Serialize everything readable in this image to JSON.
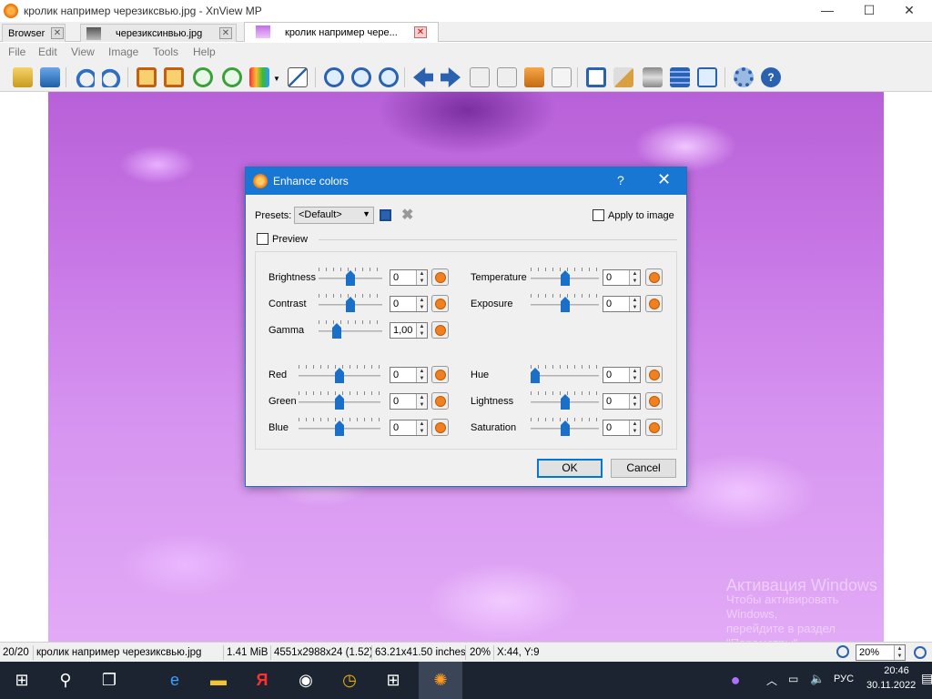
{
  "window": {
    "title": "кролик например черезиксвью.jpg - XnView MP",
    "min": "—",
    "max": "☐",
    "close": "✕"
  },
  "tabs": [
    {
      "label": "Browser"
    },
    {
      "label": "черезиксинвью.jpg"
    },
    {
      "label": "кролик например чере..."
    }
  ],
  "menu": [
    "File",
    "Edit",
    "View",
    "Image",
    "Tools",
    "Help"
  ],
  "watermark": {
    "line1": "Активация Windows",
    "line2": "Чтобы активировать Windows,",
    "line3": "перейдите в раздел \"Параметры\"."
  },
  "dialog": {
    "title": "Enhance colors",
    "help": "?",
    "close": "✕",
    "presets_label": "Presets:",
    "presets_value": "<Default>",
    "apply_label": "Apply to image",
    "preview_label": "Preview",
    "left_controls": [
      {
        "label": "Brightness",
        "value": "0",
        "level": 0.5
      },
      {
        "label": "Contrast",
        "value": "0",
        "level": 0.5
      },
      {
        "label": "Gamma",
        "value": "1,00",
        "level": 0.25
      },
      {
        "label": "Red",
        "value": "0",
        "level": 0.5
      },
      {
        "label": "Green",
        "value": "0",
        "level": 0.5
      },
      {
        "label": "Blue",
        "value": "0",
        "level": 0.5
      }
    ],
    "right_controls": [
      {
        "label": "Temperature",
        "value": "0",
        "level": 0.5
      },
      {
        "label": "Exposure",
        "value": "0",
        "level": 0.5
      },
      {
        "label": "Hue",
        "value": "0",
        "level": 0.0
      },
      {
        "label": "Lightness",
        "value": "0",
        "level": 0.5
      },
      {
        "label": "Saturation",
        "value": "0",
        "level": 0.5
      }
    ],
    "ok": "OK",
    "cancel": "Cancel"
  },
  "status": {
    "index": "20/20",
    "filename": "кролик например черезиксвью.jpg",
    "size": "1.41 MiB",
    "dims": "4551x2988x24 (1.52)",
    "inches": "63.21x41.50 inches",
    "zoom": "20%",
    "coords": "X:44, Y:9",
    "zoom_box": "20%"
  },
  "taskbar": {
    "lang": "РУС",
    "time": "20:46",
    "date": "30.11.2022"
  }
}
